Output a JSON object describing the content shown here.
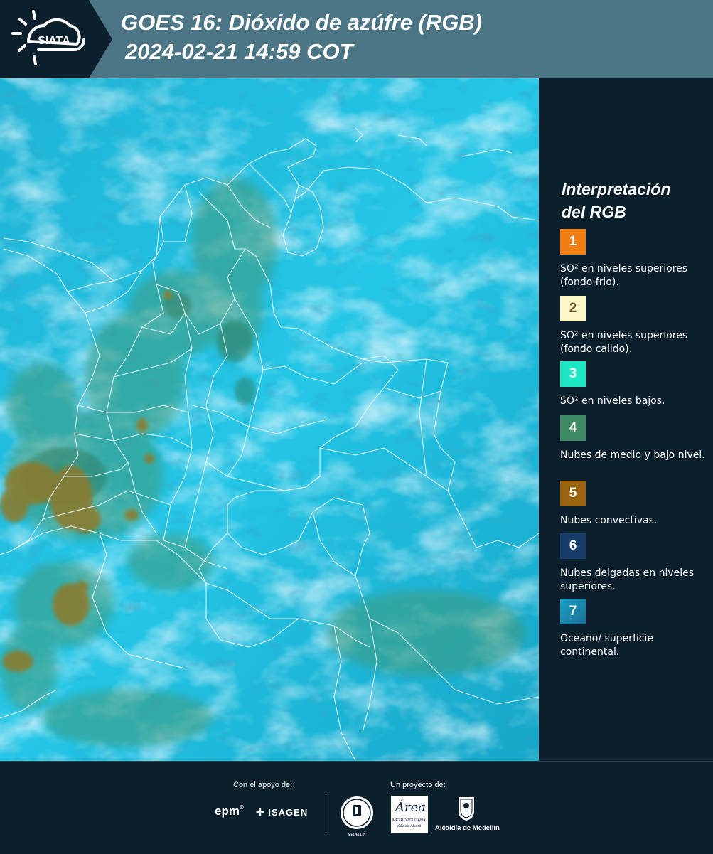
{
  "header": {
    "logo_text": "SIATA",
    "title_line1": "GOES 16: Dióxido de azúfre (RGB)",
    "title_line2": "2024-02-21 14:59 COT"
  },
  "legend": {
    "title_line1": "Interpretación",
    "title_line2": "del RGB",
    "items": [
      {
        "number": "1",
        "color": "#f07f13",
        "text": "SO² en niveles superiores (fondo frio)."
      },
      {
        "number": "2",
        "color": "#fbf7c6",
        "text": "SO² en niveles superiores (fondo calido)."
      },
      {
        "number": "3",
        "color": "#1ee8c4",
        "text": "SO² en niveles bajos."
      },
      {
        "number": "4",
        "color": "#3d8a65",
        "text": "Nubes de medio y bajo nivel."
      },
      {
        "number": "5",
        "color": "#9b6410",
        "text": "Nubes convectivas."
      },
      {
        "number": "6",
        "color": "#163c6a",
        "text": "Nubes delgadas en niveles superiores."
      },
      {
        "number": "7",
        "color": "#1f8fb5",
        "text": "Oceano/ superficie continental."
      }
    ]
  },
  "footer": {
    "support_label": "Con el apoyo de:",
    "project_label": "Un proyecto de:",
    "sponsor1": "epm",
    "sponsor2": "ISAGEN",
    "partner_metro_big": "Área",
    "partner_metro_small1": "METROPOLITANA",
    "partner_metro_small2": "Valle de Aburrá",
    "partner_alcaldia": "Alcaldía de Medellín",
    "seal_text": "MEDELLÍN"
  }
}
